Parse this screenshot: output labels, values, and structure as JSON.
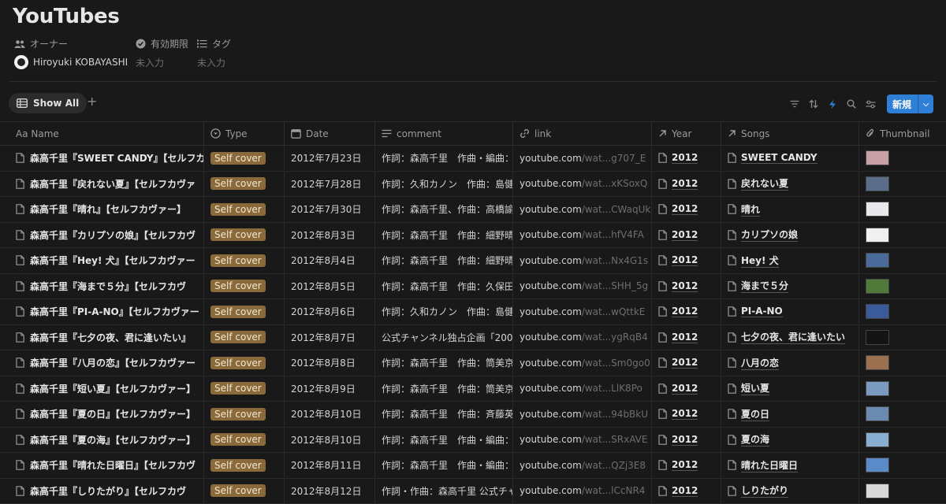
{
  "page": {
    "title": "YouTubes",
    "properties": [
      {
        "label": "オーナー",
        "icon": "people-icon",
        "value": "Hiroyuki KOBAYASHI"
      },
      {
        "label": "有効期限",
        "icon": "verified-icon",
        "value": "未入力"
      },
      {
        "label": "タグ",
        "icon": "list-icon",
        "value": "未入力"
      }
    ]
  },
  "toolbar": {
    "view_label": "Show All",
    "add_view": "+",
    "new_label": "新規",
    "icons": [
      "filter-icon",
      "sort-icon",
      "lightning-icon",
      "search-icon",
      "settings-icon"
    ],
    "accent": "#2f7fd6"
  },
  "columns": [
    "Aa Name",
    "Type",
    "Date",
    "comment",
    "link",
    "Year",
    "Songs",
    "Thumbnail"
  ],
  "rows": [
    {
      "name": "森高千里『SWEET CANDY』【セルフカ",
      "type": "Self cover",
      "date": "2012年7月23日",
      "comment": "作詞：森高千里　作曲・編曲：",
      "link_domain": "youtube.com",
      "link_tail": "/wat...g707_E",
      "year": "2012",
      "song": "SWEET CANDY",
      "thumb_color": "#c8a0a8"
    },
    {
      "name": "森高千里『戻れない夏』【セルフカヴァ",
      "type": "Self cover",
      "date": "2012年7月28日",
      "comment": "作詞：久和カノン　作曲：島健",
      "link_domain": "youtube.com",
      "link_tail": "/wat...xKSoxQ",
      "year": "2012",
      "song": "戻れない夏",
      "thumb_color": "#5a6e8c"
    },
    {
      "name": "森高千里『晴れ』【セルフカヴァー】",
      "type": "Self cover",
      "date": "2012年7月30日",
      "comment": "作詞：森高千里、作曲：高橋諭",
      "link_domain": "youtube.com",
      "link_tail": "/wat...CWaqUk",
      "year": "2012",
      "song": "晴れ",
      "thumb_color": "#e8e8ec"
    },
    {
      "name": "森高千里『カリプソの娘』【セルフカヴ",
      "type": "Self cover",
      "date": "2012年8月3日",
      "comment": "作詞：森高千里　作曲：細野晴",
      "link_domain": "youtube.com",
      "link_tail": "/wat...hfV4FA",
      "year": "2012",
      "song": "カリプソの娘",
      "thumb_color": "#f0f0f0"
    },
    {
      "name": "森高千里『Hey! 犬』【セルフカヴァー",
      "type": "Self cover",
      "date": "2012年8月4日",
      "comment": "作詞：森高千里　作曲：細野晴",
      "link_domain": "youtube.com",
      "link_tail": "/wat...Nx4G1s",
      "year": "2012",
      "song": "Hey! 犬",
      "thumb_color": "#4a6a9a"
    },
    {
      "name": "森高千里『海まで５分』【セルフカヴ",
      "type": "Self cover",
      "date": "2012年8月5日",
      "comment": "作詞：森高千里　作曲：久保田",
      "link_domain": "youtube.com",
      "link_tail": "/wat...SHH_5g",
      "year": "2012",
      "song": "海まで５分",
      "thumb_color": "#4f7a3a"
    },
    {
      "name": "森高千里『PI-A-NO』【セルフカヴァー",
      "type": "Self cover",
      "date": "2012年8月6日",
      "comment": "作詞：久和カノン　作曲：島健",
      "link_domain": "youtube.com",
      "link_tail": "/wat...wQttkE",
      "year": "2012",
      "song": "PI-A-NO",
      "thumb_color": "#3a5a9a"
    },
    {
      "name": "森高千里『七夕の夜、君に逢いたい』",
      "type": "Self cover",
      "date": "2012年8月7日",
      "comment": "公式チャンネル独占企画「200",
      "link_domain": "youtube.com",
      "link_tail": "/wat...ygRqB4",
      "year": "2012",
      "song": "七夕の夜、君に逢いたい",
      "thumb_color": "#141414"
    },
    {
      "name": "森高千里『八月の恋』【セルフカヴァー",
      "type": "Self cover",
      "date": "2012年8月8日",
      "comment": "作詞：森高千里　作曲：筒美京",
      "link_domain": "youtube.com",
      "link_tail": "/wat...Sm0go0",
      "year": "2012",
      "song": "八月の恋",
      "thumb_color": "#9a7050"
    },
    {
      "name": "森高千里『短い夏』【セルフカヴァー】",
      "type": "Self cover",
      "date": "2012年8月9日",
      "comment": "作詞：森高千里　作曲：筒美京",
      "link_domain": "youtube.com",
      "link_tail": "/wat...LlK8Po",
      "year": "2012",
      "song": "短い夏",
      "thumb_color": "#7a9ac0"
    },
    {
      "name": "森高千里『夏の日』【セルフカヴァー】",
      "type": "Self cover",
      "date": "2012年8月10日",
      "comment": "作詞：森高千里　作曲：斉藤英",
      "link_domain": "youtube.com",
      "link_tail": "/wat...94bBkU",
      "year": "2012",
      "song": "夏の日",
      "thumb_color": "#6a8ab0"
    },
    {
      "name": "森高千里『夏の海』【セルフカヴァー】",
      "type": "Self cover",
      "date": "2012年8月10日",
      "comment": "作詞：森高千里　作曲・編曲：",
      "link_domain": "youtube.com",
      "link_tail": "/wat...SRxAVE",
      "year": "2012",
      "song": "夏の海",
      "thumb_color": "#8aaed0"
    },
    {
      "name": "森高千里『晴れた日曜日』【セルフカヴ",
      "type": "Self cover",
      "date": "2012年8月11日",
      "comment": "作詞：森高千里　作曲・編曲：",
      "link_domain": "youtube.com",
      "link_tail": "/wat...QZj3E8",
      "year": "2012",
      "song": "晴れた日曜日",
      "thumb_color": "#5a8ac8"
    },
    {
      "name": "森高千里『しりたがり』【セルフカヴ",
      "type": "Self cover",
      "date": "2012年8月12日",
      "comment": "作詞・作曲：森高千里 公式チャ",
      "link_domain": "youtube.com",
      "link_tail": "/wat...lCcNR4",
      "year": "2012",
      "song": "しりたがり",
      "thumb_color": "#d8d8d8"
    }
  ]
}
